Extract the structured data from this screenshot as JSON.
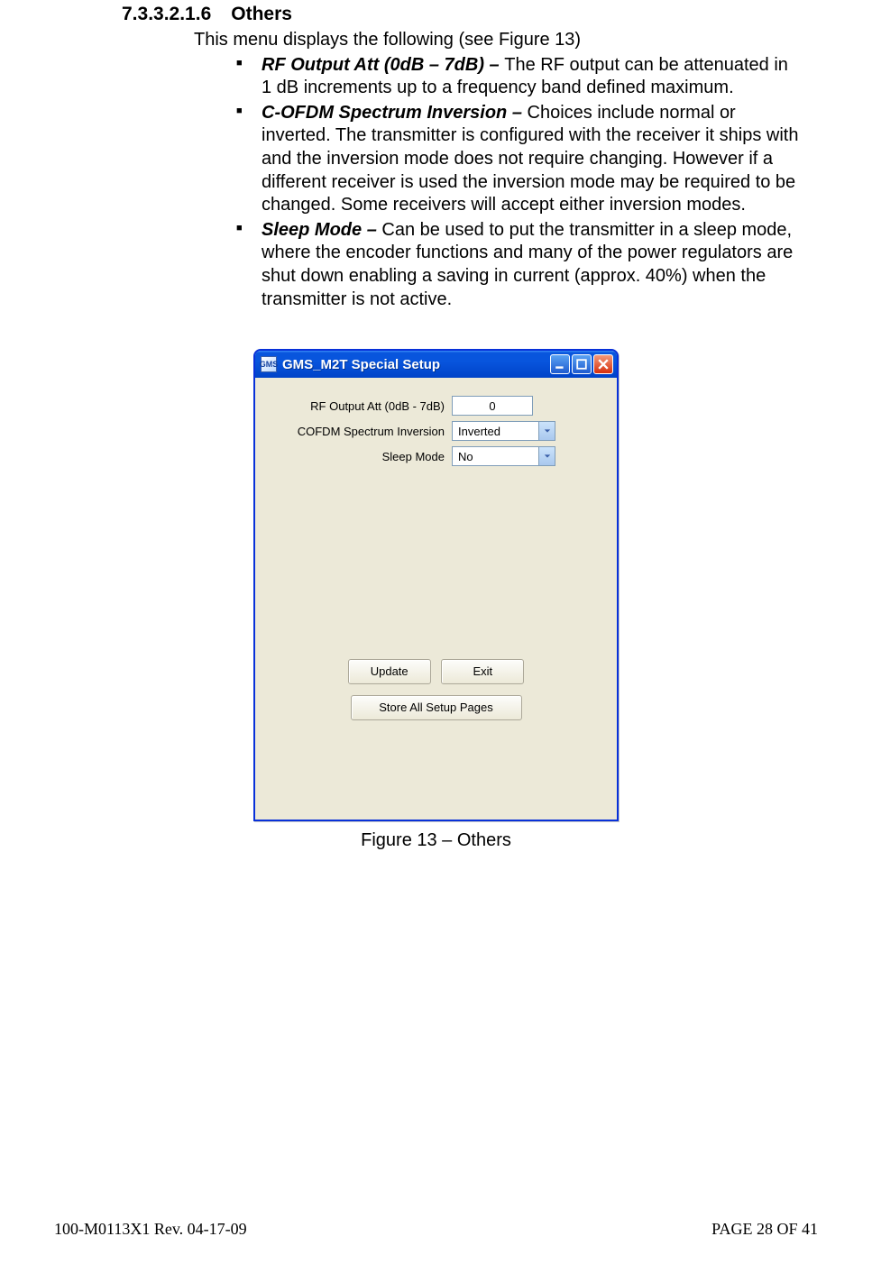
{
  "heading": {
    "number": "7.3.3.2.1.6",
    "title": "Others"
  },
  "intro": "This menu displays the following (see Figure 13)",
  "bullets": [
    {
      "label": "RF Output Att (0dB – 7dB)  – ",
      "text": "The RF output can be attenuated in 1 dB increments up to a frequency band defined maximum."
    },
    {
      "label": "C-OFDM Spectrum Inversion – ",
      "text": "Choices include normal or inverted. The transmitter is configured with the receiver it ships with and the inversion mode does not require changing. However if a different receiver is used the inversion mode may be required to be changed. Some receivers will accept either inversion modes."
    },
    {
      "label": "Sleep Mode – ",
      "text": "Can be used to put the transmitter in a sleep mode, where the encoder functions and many of the power regulators are shut down enabling a saving in current (approx. 40%) when the transmitter is not active."
    }
  ],
  "window": {
    "title": "GMS_M2T Special Setup",
    "fields": {
      "rf_label": "RF Output Att (0dB - 7dB)",
      "rf_value": "0",
      "cofdm_label": "COFDM Spectrum Inversion",
      "cofdm_value": "Inverted",
      "sleep_label": "Sleep Mode",
      "sleep_value": "No"
    },
    "buttons": {
      "update": "Update",
      "exit": "Exit",
      "store": "Store All Setup Pages"
    },
    "app_icon_text": "GMS"
  },
  "figure_caption": "Figure 13 – Others",
  "footer": {
    "left": "100-M0113X1 Rev. 04-17-09",
    "right": "PAGE 28 OF 41"
  }
}
